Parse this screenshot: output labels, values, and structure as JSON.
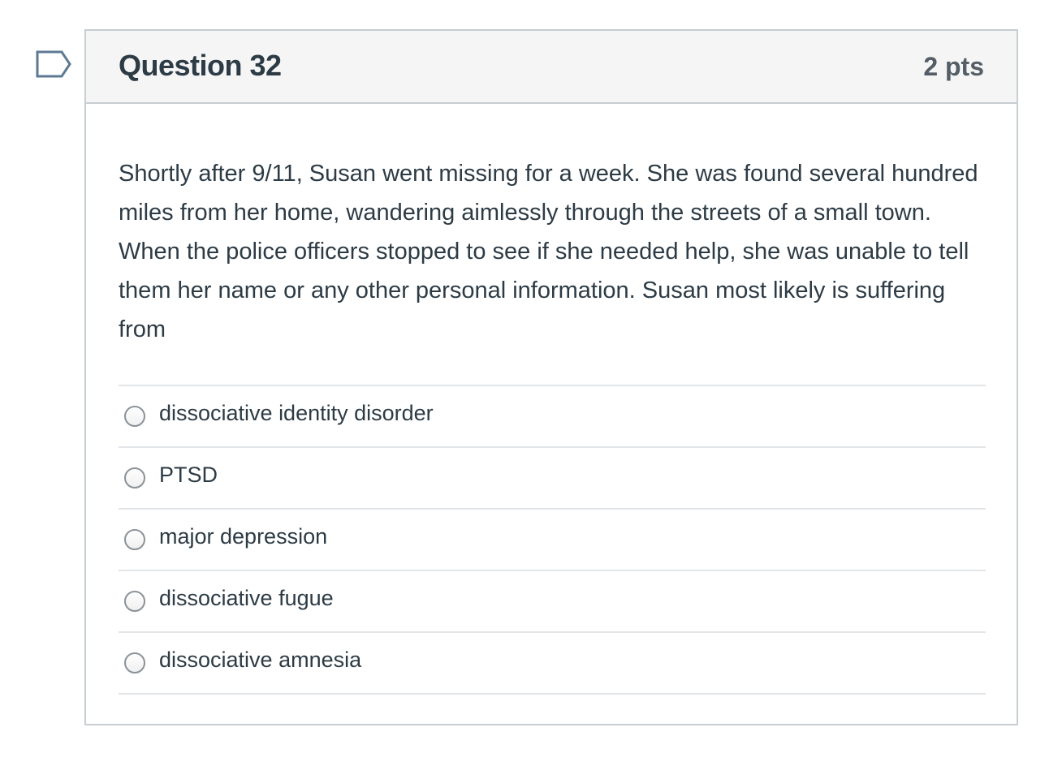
{
  "question": {
    "title": "Question 32",
    "points": "2 pts",
    "text": "Shortly after 9/11, Susan went missing for a week.  She was found several hundred miles from her home, wandering aimlessly through the streets of a small town.  When the police officers stopped to see if she needed help, she was unable to tell them her name or any other personal information.  Susan most likely is suffering from",
    "flag_icon": "flag-question-icon",
    "answers": [
      {
        "label": "dissociative identity disorder"
      },
      {
        "label": "PTSD"
      },
      {
        "label": "major depression"
      },
      {
        "label": "dissociative fugue"
      },
      {
        "label": "dissociative amnesia"
      }
    ]
  },
  "colors": {
    "border": "#c7cdd1",
    "header_bg": "#f5f5f5",
    "text": "#2d3b45",
    "flag": "#5d7a93"
  }
}
